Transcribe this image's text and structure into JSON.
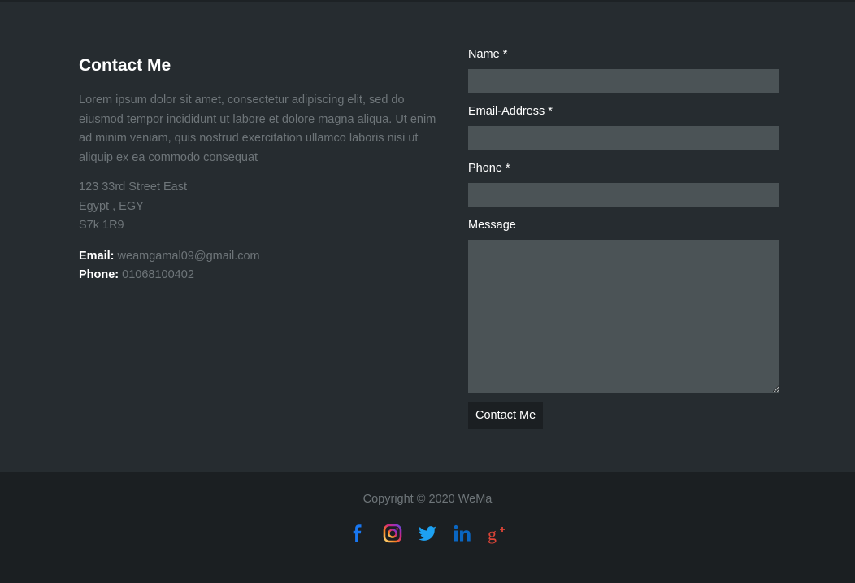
{
  "contact": {
    "title": "Contact Me",
    "description": "Lorem ipsum dolor sit amet, consectetur adipiscing elit, sed do eiusmod tempor incididunt ut labore et dolore magna aliqua. Ut enim ad minim veniam, quis nostrud exercitation ullamco laboris nisi ut aliquip ex ea commodo consequat",
    "address": [
      "123 33rd Street East",
      "Egypt , EGY",
      "S7k 1R9"
    ],
    "email_label": "Email:",
    "email_value": "weamgamal09@gmail.com",
    "phone_label": "Phone:",
    "phone_value": "01068100402"
  },
  "form": {
    "name_label": "Name *",
    "name_value": "",
    "email_label": "Email-Address *",
    "email_value": "",
    "phone_label": "Phone *",
    "phone_value": "",
    "message_label": "Message",
    "message_value": "",
    "submit_label": "Contact Me"
  },
  "footer": {
    "copyright": "Copyright © 2020 WeMa",
    "socials": [
      {
        "icon": "facebook-icon",
        "color": "#1877f2"
      },
      {
        "icon": "instagram-icon",
        "color": "#e1306c"
      },
      {
        "icon": "twitter-icon",
        "color": "#1da1f2"
      },
      {
        "icon": "linkedin-icon",
        "color": "#0a66c2"
      },
      {
        "icon": "google-plus-icon",
        "color": "#db4437"
      }
    ]
  }
}
